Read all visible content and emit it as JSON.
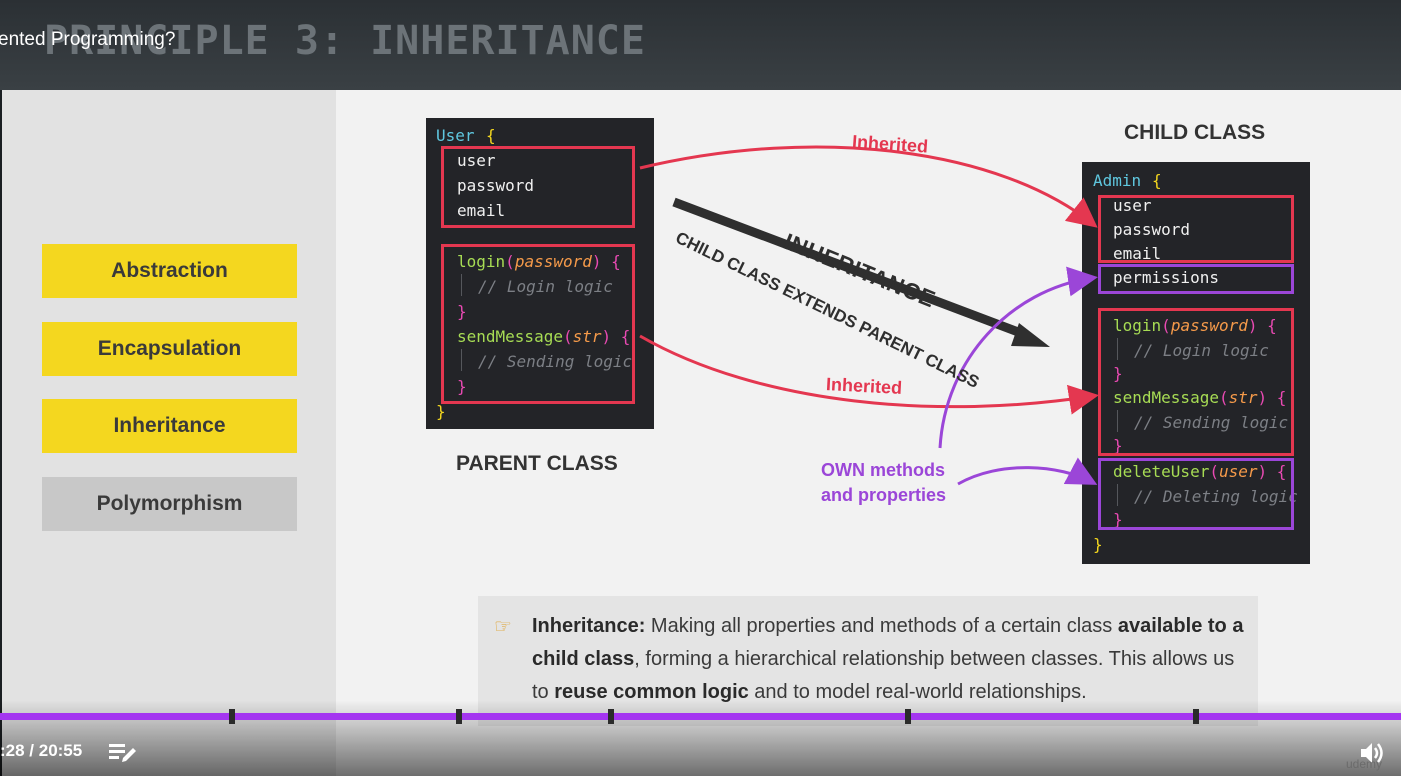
{
  "header": {
    "slide_title": "PRINCIPLE 3: INHERITANCE",
    "video_title": "ented Programming?"
  },
  "principles": [
    {
      "label": "Abstraction",
      "state": "highlighted"
    },
    {
      "label": "Encapsulation",
      "state": "highlighted"
    },
    {
      "label": "Inheritance",
      "state": "highlighted"
    },
    {
      "label": "Polymorphism",
      "state": "dimmed"
    }
  ],
  "parent_class": {
    "caption": "PARENT CLASS",
    "class_name": "User",
    "open_brace": "{",
    "close_brace": "}",
    "properties": [
      "user",
      "password",
      "email"
    ],
    "methods": {
      "login_name": "login",
      "login_param": "password",
      "login_tail": "{",
      "login_comment": "// Login logic",
      "login_close": "}",
      "send_name": "sendMessage",
      "send_param": "str",
      "send_tail": "{",
      "send_comment": "// Sending logic",
      "send_close": "}"
    }
  },
  "child_class": {
    "caption": "CHILD CLASS",
    "class_name": "Admin",
    "open_brace": "{",
    "close_brace": "}",
    "properties": [
      "user",
      "password",
      "email"
    ],
    "own_property": "permissions",
    "methods": {
      "login_name": "login",
      "login_param": "password",
      "login_tail": "{",
      "login_comment": "// Login logic",
      "login_close": "}",
      "send_name": "sendMessage",
      "send_param": "str",
      "send_tail": "{",
      "send_comment": "// Sending logic",
      "send_close": "}",
      "delete_name": "deleteUser",
      "delete_param": "user",
      "delete_tail": "{",
      "delete_comment": "// Deleting logic",
      "delete_close": "}"
    }
  },
  "diagram": {
    "inherited_top": "Inherited",
    "inherited_bottom": "Inherited",
    "inheritance_word": "INHERITANCE",
    "extends_phrase": "CHILD CLASS EXTENDS PARENT CLASS",
    "own_line1": "OWN methods",
    "own_line2": "and properties"
  },
  "note": {
    "term": "Inheritance:",
    "part1": " Making all properties and methods of a certain class ",
    "bold1": "available to a child class",
    "part2": ", forming a hierarchical relationship between classes. This allows us to ",
    "bold2": "reuse common logic",
    "part3": " and to model real-world relationships."
  },
  "player": {
    "time": ":28 / 20:55",
    "watermark": "udemy",
    "progress_color": "#a435f0"
  },
  "colors": {
    "accent_yellow": "#f4d71f",
    "inherited_red": "#e43750",
    "own_purple": "#9b46d8",
    "code_bg": "#232428"
  },
  "icons": [
    "pointing-hand-icon",
    "transcript-icon",
    "volume-icon"
  ]
}
